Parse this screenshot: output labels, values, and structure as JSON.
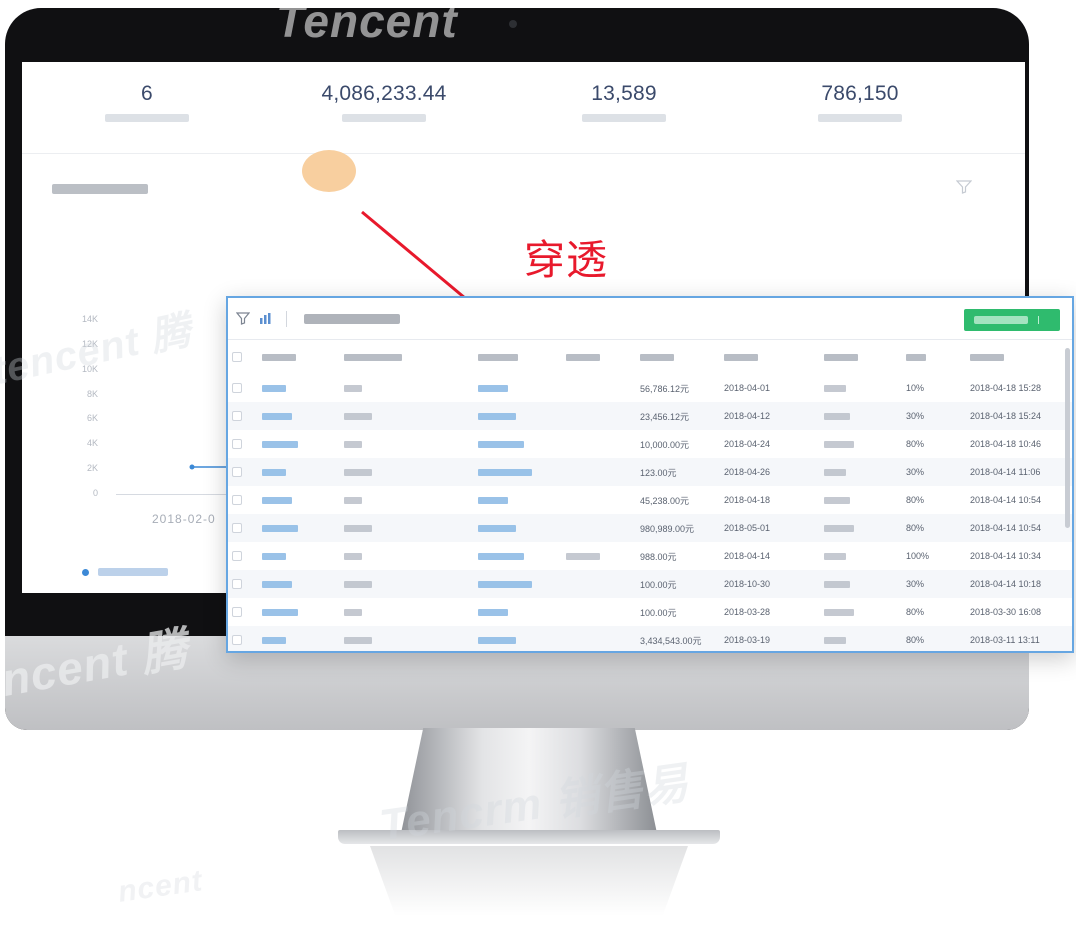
{
  "kpis": [
    {
      "value": "6",
      "label": ""
    },
    {
      "value": "4,086,233.44",
      "label": ""
    },
    {
      "value": "13,589",
      "label": ""
    },
    {
      "value": "786,150",
      "label": ""
    }
  ],
  "chart_data": {
    "type": "line",
    "title": "",
    "yticks": [
      "14K",
      "12K",
      "10K",
      "8K",
      "6K",
      "4K",
      "2K",
      "0"
    ],
    "ylim": [
      0,
      14000
    ],
    "x": [
      "2018-02-0"
    ],
    "series": [
      {
        "values": [
          0
        ]
      }
    ],
    "colors": {
      "line": "#3c89d6"
    },
    "grid": false
  },
  "annotation": {
    "label": "穿透",
    "color": "#e8192c"
  },
  "popup": {
    "title": "",
    "button_label": "",
    "accent": "#2fbb6e",
    "columns": [
      "",
      "",
      "",
      "",
      "",
      "",
      "",
      "",
      "",
      ""
    ],
    "rows": [
      {
        "amount": "56,786.12元",
        "date": "2018-04-01",
        "pct": "10%",
        "created": "2018-04-18 15:28"
      },
      {
        "amount": "23,456.12元",
        "date": "2018-04-12",
        "pct": "30%",
        "created": "2018-04-18 15:24"
      },
      {
        "amount": "10,000.00元",
        "date": "2018-04-24",
        "pct": "80%",
        "created": "2018-04-18 10:46"
      },
      {
        "amount": "123.00元",
        "date": "2018-04-26",
        "pct": "30%",
        "created": "2018-04-14 11:06"
      },
      {
        "amount": "45,238.00元",
        "date": "2018-04-18",
        "pct": "80%",
        "created": "2018-04-14 10:54"
      },
      {
        "amount": "980,989.00元",
        "date": "2018-05-01",
        "pct": "80%",
        "created": "2018-04-14 10:54"
      },
      {
        "amount": "988.00元",
        "date": "2018-04-14",
        "pct": "100%",
        "created": "2018-04-14 10:34"
      },
      {
        "amount": "100.00元",
        "date": "2018-10-30",
        "pct": "30%",
        "created": "2018-04-14 10:18"
      },
      {
        "amount": "100.00元",
        "date": "2018-03-28",
        "pct": "80%",
        "created": "2018-03-30 16:08"
      },
      {
        "amount": "3,434,543.00元",
        "date": "2018-03-19",
        "pct": "80%",
        "created": "2018-03-11 13:11"
      }
    ]
  },
  "watermarks": [
    "Tencent",
    "ncent",
    "ncent 腾",
    "tencent 腾",
    "Tencrm 销售易"
  ]
}
